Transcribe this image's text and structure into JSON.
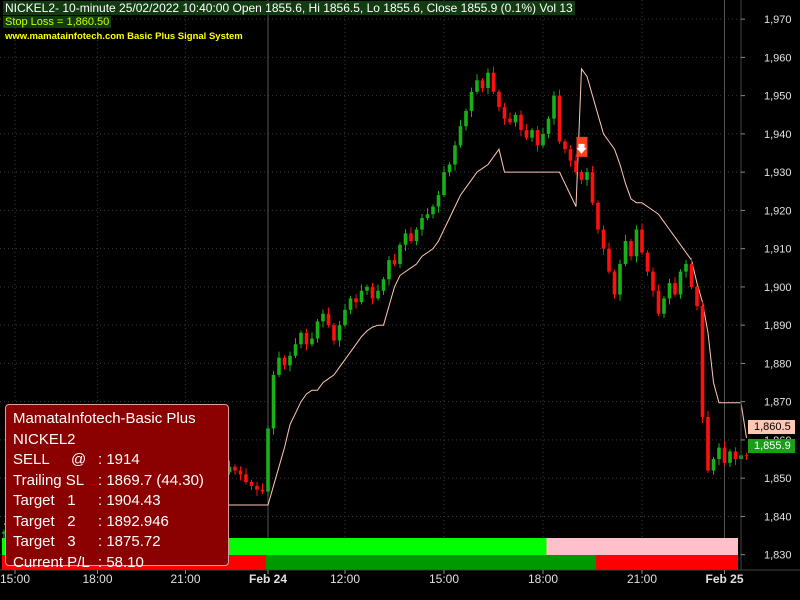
{
  "header": {
    "title": "NICKEL2- 10-minute 25/02/2022 10:40:00 Open 1855.6, Hi 1856.5, Lo 1855.6, Close 1855.9 (0.1%) Vol 13",
    "stop_loss": "Stop Loss = 1,860.50",
    "website": "www.mamatainfotech.com Basic Plus Signal System"
  },
  "info_box": {
    "title": "MamataInfotech-Basic Plus",
    "symbol": "NICKEL2",
    "rows": [
      {
        "label": "SELL",
        "at": "@",
        "value": ": 1914"
      },
      {
        "label": "Trailing SL",
        "value": ": 1869.7 (44.30)"
      },
      {
        "label": "Target   1",
        "value": ": 1904.43"
      },
      {
        "label": "Target   2",
        "value": ": 1892.946"
      },
      {
        "label": "Target   3",
        "value": ": 1875.72"
      },
      {
        "label": "Current P/L",
        "value": ": 58.10"
      }
    ]
  },
  "price_tags": {
    "stop_loss": "1,860.5",
    "close": "1,855.9"
  },
  "colors": {
    "up": "#18b018",
    "down": "#ff1010",
    "trail": "#ffc8b4",
    "signal": "#ff4020",
    "bright_green": "#00ff00",
    "pink": "#ffc0cb",
    "red": "#ff0000",
    "dark_green": "#009900"
  },
  "chart_data": {
    "type": "candlestick",
    "ylim": [
      1826,
      1975
    ],
    "y_ticks": [
      1830,
      1840,
      1850,
      1860,
      1870,
      1880,
      1890,
      1900,
      1910,
      1920,
      1930,
      1940,
      1950,
      1960,
      1970
    ],
    "y_tick_labels": [
      "1,830",
      "1,840",
      "1,850",
      "1,860",
      "1,870",
      "1,880",
      "1,890",
      "1,900",
      "1,910",
      "1,920",
      "1,930",
      "1,940",
      "1,950",
      "1,960",
      "1,970"
    ],
    "x_ticks": [
      {
        "bar": 2,
        "label": "15:00",
        "bold": false
      },
      {
        "bar": 17,
        "label": "18:00",
        "bold": false
      },
      {
        "bar": 33,
        "label": "21:00",
        "bold": false
      },
      {
        "bar": 48,
        "label": "Feb 24",
        "bold": true
      },
      {
        "bar": 62,
        "label": "12:00",
        "bold": false
      },
      {
        "bar": 80,
        "label": "15:00",
        "bold": false
      },
      {
        "bar": 98,
        "label": "18:00",
        "bold": false
      },
      {
        "bar": 116,
        "label": "21:00",
        "bold": false
      },
      {
        "bar": 131,
        "label": "Feb 25",
        "bold": true
      }
    ],
    "closes": [
      1836,
      1834.5,
      1836.5,
      1838,
      1840,
      1841,
      1842.5,
      1843.5,
      1845,
      1846.5,
      1847,
      1848.5,
      1849,
      1850,
      1851,
      1852.5,
      1853,
      1852,
      1853.5,
      1852.5,
      1854,
      1855,
      1854,
      1855.5,
      1856.5,
      1856,
      1857,
      1856.5,
      1858,
      1857.5,
      1859,
      1858,
      1857,
      1856,
      1855.5,
      1854,
      1853,
      1852,
      1851,
      1850,
      1851.5,
      1853,
      1852,
      1851,
      1849,
      1848,
      1847,
      1846.5,
      1863,
      1877,
      1881.5,
      1879.5,
      1882,
      1885,
      1888,
      1885,
      1886.5,
      1891,
      1893,
      1890,
      1886,
      1890,
      1894,
      1897,
      1896,
      1899,
      1900,
      1897,
      1899,
      1902,
      1907,
      1906,
      1911,
      1914,
      1912,
      1915,
      1918,
      1919,
      1921,
      1924,
      1930,
      1932,
      1937,
      1942,
      1946,
      1951,
      1954,
      1952,
      1956,
      1951,
      1947,
      1944,
      1943,
      1945,
      1941,
      1939,
      1941,
      1937,
      1940,
      1944,
      1950,
      1938,
      1936,
      1933,
      1930,
      1928,
      1930,
      1922,
      1915,
      1910,
      1904,
      1898,
      1906,
      1912,
      1908,
      1915,
      1909,
      1904,
      1899,
      1893,
      1897,
      1901,
      1898,
      1904,
      1906,
      1900,
      1895,
      1866,
      1852,
      1855,
      1858,
      1854,
      1857,
      1855,
      1856,
      1855.9
    ],
    "trailing_stop": [
      1838,
      1838,
      1839,
      1839,
      1840,
      1840,
      1841,
      1841,
      1842,
      1843,
      1843,
      1844,
      1845,
      1845,
      1845.5,
      1846,
      1847,
      1847,
      1847.5,
      1848,
      1848,
      1848.5,
      1849,
      1849,
      1849.5,
      1850,
      1850,
      1851,
      1851,
      1851.5,
      1852,
      1852.5,
      1852.5,
      1851,
      1849,
      1848,
      1846.5,
      1845.5,
      1844.5,
      1843.5,
      1843,
      1843,
      1843,
      1843,
      1843,
      1843,
      1843,
      1843,
      1843,
      1848,
      1853,
      1858,
      1864,
      1867,
      1870,
      1872,
      1873,
      1873,
      1875,
      1876,
      1877,
      1879,
      1881,
      1883,
      1885,
      1887,
      1888.5,
      1889.5,
      1890,
      1890,
      1895,
      1900,
      1903,
      1904,
      1905,
      1906,
      1908,
      1909,
      1910,
      1912,
      1915,
      1918,
      1921,
      1924,
      1926,
      1928,
      1930,
      1931,
      1932,
      1934,
      1936,
      1930,
      1930,
      1930,
      1930,
      1930,
      1930,
      1930,
      1930,
      1930,
      1930,
      1930,
      1927,
      1924,
      1921,
      1957,
      1955,
      1950,
      1945,
      1940,
      1938,
      1936,
      1932,
      1927,
      1923,
      1922,
      1922,
      1921,
      1920,
      1919,
      1917,
      1915,
      1913,
      1911,
      1909,
      1907,
      1901,
      1896,
      1888,
      1875,
      1869.7,
      1869.7,
      1869.7,
      1869.7,
      1869.7,
      1860.5
    ],
    "sell_signal_bar": 105,
    "bands": [
      {
        "from": 0,
        "to": 99,
        "color": "#00ff00"
      },
      {
        "from": 99,
        "to": 134,
        "color": "#ffc0cb"
      }
    ],
    "bottom_bands": [
      {
        "from": 0,
        "to": 48,
        "color": "#ff0000"
      },
      {
        "from": 48,
        "to": 108,
        "color": "#009900"
      },
      {
        "from": 108,
        "to": 134,
        "color": "#ff0000"
      }
    ],
    "vertical_separators": [
      48,
      131
    ]
  }
}
